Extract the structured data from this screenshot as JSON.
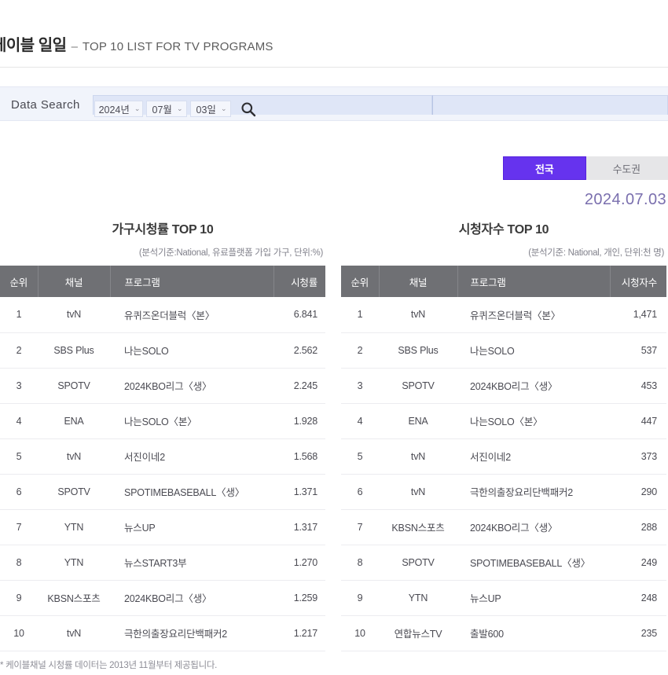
{
  "header": {
    "title_ko": "케이블 일일",
    "dash": "–",
    "title_en": "TOP 10 LIST FOR TV PROGRAMS"
  },
  "search": {
    "label": "Data Search",
    "year": "2024년",
    "month": "07월",
    "day": "03일",
    "caret": "⌄",
    "search_icon": "search-icon"
  },
  "region_toggle": {
    "active": "전국",
    "inactive": "수도권",
    "active_color": "#6633ee"
  },
  "date_label": "2024.07.03",
  "footnote": "* 케이블채널 시청률 데이터는 2013년 11월부터 제공됩니다.",
  "panels": [
    {
      "title": "가구시청률 TOP 10",
      "subtitle": "(분석기준:National, 유료플랫폼 가입 가구, 단위:%)",
      "columns": [
        "순위",
        "채널",
        "프로그램",
        "시청률"
      ],
      "rows": [
        {
          "rank": "1",
          "channel": "tvN",
          "program": "유퀴즈온더블럭〈본〉",
          "value": "6.841"
        },
        {
          "rank": "2",
          "channel": "SBS Plus",
          "program": "나는SOLO",
          "value": "2.562"
        },
        {
          "rank": "3",
          "channel": "SPOTV",
          "program": "2024KBO리그〈생〉",
          "value": "2.245"
        },
        {
          "rank": "4",
          "channel": "ENA",
          "program": "나는SOLO〈본〉",
          "value": "1.928"
        },
        {
          "rank": "5",
          "channel": "tvN",
          "program": "서진이네2",
          "value": "1.568"
        },
        {
          "rank": "6",
          "channel": "SPOTV",
          "program": "SPOTIMEBASEBALL〈생〉",
          "value": "1.371"
        },
        {
          "rank": "7",
          "channel": "YTN",
          "program": "뉴스UP",
          "value": "1.317"
        },
        {
          "rank": "8",
          "channel": "YTN",
          "program": "뉴스START3부",
          "value": "1.270"
        },
        {
          "rank": "9",
          "channel": "KBSN스포츠",
          "program": "2024KBO리그〈생〉",
          "value": "1.259"
        },
        {
          "rank": "10",
          "channel": "tvN",
          "program": "극한의출장요리단백패커2",
          "value": "1.217"
        }
      ]
    },
    {
      "title": "시청자수 TOP 10",
      "subtitle": "(분석기준: National, 개인, 단위:천 명)",
      "columns": [
        "순위",
        "채널",
        "프로그램",
        "시청자수"
      ],
      "rows": [
        {
          "rank": "1",
          "channel": "tvN",
          "program": "유퀴즈온더블럭〈본〉",
          "value": "1,471"
        },
        {
          "rank": "2",
          "channel": "SBS Plus",
          "program": "나는SOLO",
          "value": "537"
        },
        {
          "rank": "3",
          "channel": "SPOTV",
          "program": "2024KBO리그〈생〉",
          "value": "453"
        },
        {
          "rank": "4",
          "channel": "ENA",
          "program": "나는SOLO〈본〉",
          "value": "447"
        },
        {
          "rank": "5",
          "channel": "tvN",
          "program": "서진이네2",
          "value": "373"
        },
        {
          "rank": "6",
          "channel": "tvN",
          "program": "극한의출장요리단백패커2",
          "value": "290"
        },
        {
          "rank": "7",
          "channel": "KBSN스포츠",
          "program": "2024KBO리그〈생〉",
          "value": "288"
        },
        {
          "rank": "8",
          "channel": "SPOTV",
          "program": "SPOTIMEBASEBALL〈생〉",
          "value": "249"
        },
        {
          "rank": "9",
          "channel": "YTN",
          "program": "뉴스UP",
          "value": "248"
        },
        {
          "rank": "10",
          "channel": "연합뉴스TV",
          "program": "출발600",
          "value": "235"
        }
      ]
    }
  ]
}
